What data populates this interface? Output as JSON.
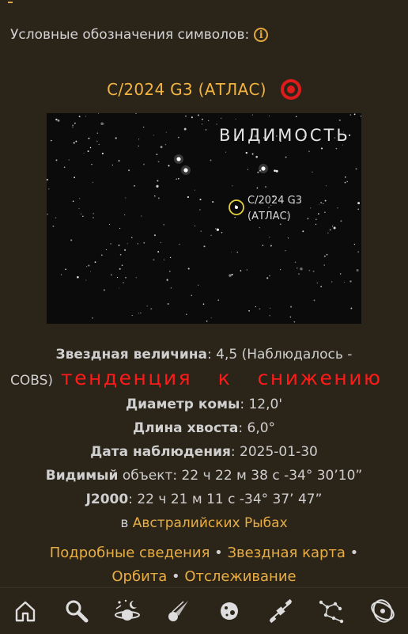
{
  "legend": {
    "label": "Условные обозначения символов:"
  },
  "comet": {
    "title": "C/2024 G3 (АТЛАС)"
  },
  "sky": {
    "visibility_label": "ВИДИМОСТЬ",
    "object_label_line1": "C/2024 G3",
    "object_label_line2": "(АТЛАС)"
  },
  "details": {
    "magnitude_label": "Звездная величина",
    "magnitude_value": ": 4,5 (Наблюдалось -",
    "magnitude_source": "COBS)",
    "trend": "тенденция к снижению",
    "coma_label": "Диаметр комы",
    "coma_value": ": 12,0'",
    "tail_label": "Длина хвоста",
    "tail_value": ": 6,0°",
    "date_label": "Дата наблюдения",
    "date_value": ": 2025-01-30",
    "apparent_label": "Видимый",
    "apparent_value": " объект: 22 ч 22 м 38 с -34° 30’10”",
    "j2000_label": "J2000",
    "j2000_value": ": 22 ч 21 м 11 с -34° 37’ 47”",
    "in_prefix": "в ",
    "constellation": "Австралийских Рыбах"
  },
  "links": {
    "details": "Подробные сведения",
    "star_map": "Звездная карта",
    "orbit": "Орбита",
    "tracking": "Отслеживание",
    "separator": " • "
  },
  "nav": {
    "icons": [
      "home-icon",
      "search-icon",
      "sky-icon",
      "comet-icon",
      "asteroid-icon",
      "satellite-icon",
      "constellation-icon",
      "orbits-icon"
    ]
  },
  "colors": {
    "accent": "#e9ae43",
    "alert": "#ff1a1a",
    "background": "#2b2419",
    "target": "#e01b1b"
  }
}
